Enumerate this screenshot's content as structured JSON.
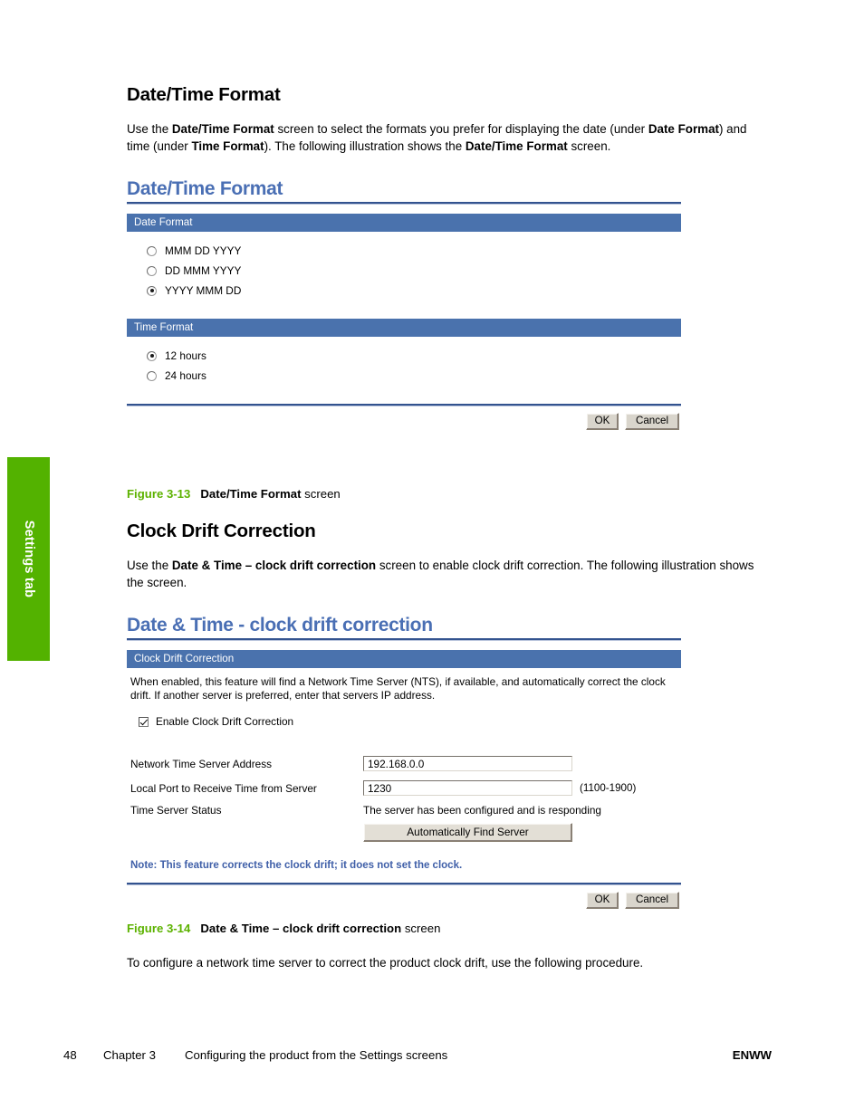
{
  "side_tab": {
    "label": "Settings tab",
    "color": "#53b200"
  },
  "colors": {
    "green": "#5cb200",
    "ews_title_blue": "#4a6fb4",
    "ews_bar_blue": "#4a72ad",
    "note_blue": "#3f5fa8"
  },
  "section1": {
    "heading": "Date/Time Format",
    "paragraph": {
      "part1": "Use the ",
      "bold1": "Date/Time Format",
      "part2": " screen to select the formats you prefer for displaying the date (under ",
      "bold2": "Date Format",
      "part3": ") and time (under ",
      "bold3": "Time Format",
      "part4": "). The following illustration shows the ",
      "bold4": "Date/Time Format",
      "part5": " screen."
    }
  },
  "screen1": {
    "title": "Date/Time Format",
    "date_format": {
      "bar_label": "Date Format",
      "options": [
        {
          "label": "MMM DD YYYY",
          "selected": false
        },
        {
          "label": "DD MMM YYYY",
          "selected": false
        },
        {
          "label": "YYYY MMM DD",
          "selected": true
        }
      ]
    },
    "time_format": {
      "bar_label": "Time Format",
      "options": [
        {
          "label": "12 hours",
          "selected": true
        },
        {
          "label": "24 hours",
          "selected": false
        }
      ]
    },
    "buttons": {
      "ok": "OK",
      "cancel": "Cancel"
    }
  },
  "figure1": {
    "number": "Figure 3-13",
    "label": "Date/Time Format",
    "suffix": " screen"
  },
  "section2": {
    "heading": "Clock Drift Correction",
    "paragraph": {
      "part1": "Use the ",
      "bold1": "Date & Time – clock drift correction",
      "part2": " screen to enable clock drift correction. The following illustration shows the screen."
    }
  },
  "screen2": {
    "title": "Date & Time - clock drift correction",
    "bar_label": "Clock Drift Correction",
    "description": "When enabled, this feature will find a Network Time Server (NTS), if available, and automatically correct the clock drift. If another server is preferred, enter that servers IP address.",
    "enable_checkbox": {
      "label": "Enable Clock Drift Correction",
      "checked": true
    },
    "fields": [
      {
        "label": "Network Time Server Address",
        "value": "192.168.0.0",
        "hint": ""
      },
      {
        "label": "Local Port to Receive Time from Server",
        "value": "1230",
        "hint": "(1100-1900)"
      }
    ],
    "status": {
      "label": "Time Server Status",
      "value": "The server has been configured and is responding"
    },
    "find_button": "Automatically Find Server",
    "note": "Note: This feature corrects the clock drift; it does not set the clock.",
    "buttons": {
      "ok": "OK",
      "cancel": "Cancel"
    }
  },
  "figure2": {
    "number": "Figure 3-14",
    "label": "Date & Time – clock drift correction",
    "suffix": " screen"
  },
  "closing_paragraph": "To configure a network time server to correct the product clock drift, use the following procedure.",
  "footer": {
    "page_number": "48",
    "chapter": "Chapter 3",
    "chapter_title": "Configuring the product from the Settings screens",
    "edition": "ENWW"
  }
}
